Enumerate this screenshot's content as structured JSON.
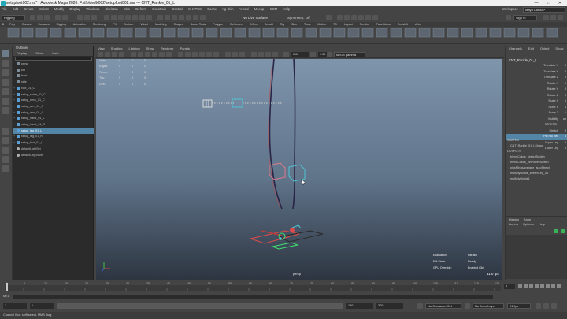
{
  "window": {
    "title": "setupfoot002.ma* - Autodesk Maya 2020: F:\\tfolder\\k002\\setupfoot002.ma  ---  CNT_Rankle_01_L",
    "minimize": "—",
    "maximize": "□",
    "close": "✕"
  },
  "menubar": [
    "File",
    "Edit",
    "Create",
    "Select",
    "Modify",
    "Display",
    "Windows",
    "Skeleton",
    "Skin",
    "Deform",
    "Constrain",
    "Control",
    "SHAPES",
    "Cache",
    "ng-Skin",
    "Arnold",
    "Mocap",
    "CGM",
    "Help"
  ],
  "menubar_right": {
    "workspace_label": "Workspace",
    "workspace_value": "Maya Classic*"
  },
  "statusline": {
    "mode": "Rigging",
    "live_surface": "No Live Surface",
    "symmetry": "Symmetry: Off",
    "signin": "Sign In"
  },
  "shelf_tabs": [
    "Poly",
    "Curves",
    "Surfaces",
    "Rigging",
    "Animation",
    "Rendering",
    "FX",
    "Custom",
    "Volsel",
    "Modeling",
    "Shapes",
    "Bonus Tools",
    "Polygon",
    "Deformers",
    "XGen",
    "Arnold",
    "Rig",
    "Skin",
    "Tools",
    "Motion",
    "TD",
    "Layout",
    "Render",
    "PanelMenu",
    "Redshift",
    "Anim"
  ],
  "outliner": {
    "title": "Outliner",
    "menu": [
      "Display",
      "Show",
      "Help"
    ],
    "rows": [
      {
        "label": "persp",
        "selected": false
      },
      {
        "label": "top",
        "selected": false
      },
      {
        "label": "front",
        "selected": false
      },
      {
        "label": "side",
        "selected": false
      },
      {
        "label": "root_01_C",
        "selected": false
      },
      {
        "label": "setup_spine_01_C",
        "selected": false
      },
      {
        "label": "setup_neck_01_C",
        "selected": false
      },
      {
        "label": "setup_arm_01_R",
        "selected": false
      },
      {
        "label": "setup_arm_01_L",
        "selected": false
      },
      {
        "label": "setup_hand_01_L",
        "selected": false
      },
      {
        "label": "setup_hand_01_R",
        "selected": false
      },
      {
        "label": "setup_leg_01_L",
        "selected": true
      },
      {
        "label": "setup_leg_01_R",
        "selected": false
      },
      {
        "label": "setup_foot_01_L",
        "selected": false
      },
      {
        "label": "defaultLightSet",
        "selected": false
      },
      {
        "label": "defaultObjectSet",
        "selected": false
      }
    ]
  },
  "viewport": {
    "menu": [
      "View",
      "Shading",
      "Lighting",
      "Show",
      "Renderer",
      "Panels"
    ],
    "near": "0.00",
    "far": "1.00",
    "colorspace": "sRGB gamma",
    "camera": "persp",
    "hud_left": [
      {
        "label": "Verts:",
        "v1": "0",
        "v2": "0",
        "v3": "0"
      },
      {
        "label": "Edges:",
        "v1": "0",
        "v2": "0",
        "v3": "0"
      },
      {
        "label": "Faces:",
        "v1": "0",
        "v2": "0",
        "v3": "0"
      },
      {
        "label": "Tris:",
        "v1": "0",
        "v2": "0",
        "v3": "0"
      },
      {
        "label": "UVs:",
        "v1": "0",
        "v2": "0",
        "v3": "0"
      }
    ],
    "hud_right": [
      {
        "label": "Evaluation:",
        "value": "Parallel"
      },
      {
        "label": "EM State:",
        "value": "Ready"
      },
      {
        "label": "GPU Override:",
        "value": "Enabled (0k)"
      }
    ],
    "fps": "11.0 fps"
  },
  "channelbox": {
    "tabs": [
      "Channels",
      "Edit",
      "Object",
      "Show"
    ],
    "object": "CNT_Rankle_01_L",
    "attributes": [
      {
        "name": "Translate X",
        "value": "0",
        "hl": false
      },
      {
        "name": "Translate Y",
        "value": "0",
        "hl": false
      },
      {
        "name": "Translate Z",
        "value": "0",
        "hl": false
      },
      {
        "name": "Rotate X",
        "value": "0",
        "hl": false
      },
      {
        "name": "Rotate Y",
        "value": "0",
        "hl": false
      },
      {
        "name": "Rotate Z",
        "value": "0",
        "hl": false
      },
      {
        "name": "Scale X",
        "value": "1",
        "hl": false
      },
      {
        "name": "Scale Y",
        "value": "1",
        "hl": false
      },
      {
        "name": "Scale Z",
        "value": "1",
        "hl": false
      },
      {
        "name": "Visibility",
        "value": "on",
        "hl": false
      },
      {
        "name": "STRETCH",
        "value": "",
        "hl": false
      },
      {
        "name": "Stretch",
        "value": "0",
        "hl": false
      },
      {
        "name": "Pin Pol Vec",
        "value": "0",
        "hl": true
      },
      {
        "name": "Upper Leg",
        "value": "0",
        "hl": false
      },
      {
        "name": "Lower Leg",
        "value": "0",
        "hl": false
      }
    ],
    "shapes_header": "SHAPES",
    "shapes": [
      "CNT_Rankle_01_LShape"
    ],
    "outputs_header": "OUTPUTS",
    "outputs": [
      "blendColors_stretchSwitch",
      "blendColors_pinPolvecSwitch",
      "plusMinusAverage_autoStretch",
      "multiplyDivide_stretchLeg_01",
      "multiplyDivide1"
    ],
    "layer_tabs": [
      "Display",
      "Anim"
    ],
    "layer_menu": [
      "Layers",
      "Options",
      "Help"
    ]
  },
  "timeline": {
    "ticks": [
      "1",
      "5",
      "10",
      "15",
      "20",
      "25",
      "30",
      "35",
      "40",
      "45",
      "50",
      "55",
      "60",
      "65",
      "70",
      "75",
      "80",
      "85",
      "90",
      "95",
      "100",
      "105",
      "110",
      "115",
      "120"
    ],
    "current": "1"
  },
  "range": {
    "start": "1",
    "inner_start": "1",
    "inner_end": "120",
    "end": "120",
    "anim_end": "200",
    "character_set": "No Character Set",
    "anim_layer": "No Anim Layer",
    "fps": "24 fps"
  },
  "cmdline": {
    "label": "MEL"
  },
  "helpline": "Channel Box: shift select, MMB drag"
}
